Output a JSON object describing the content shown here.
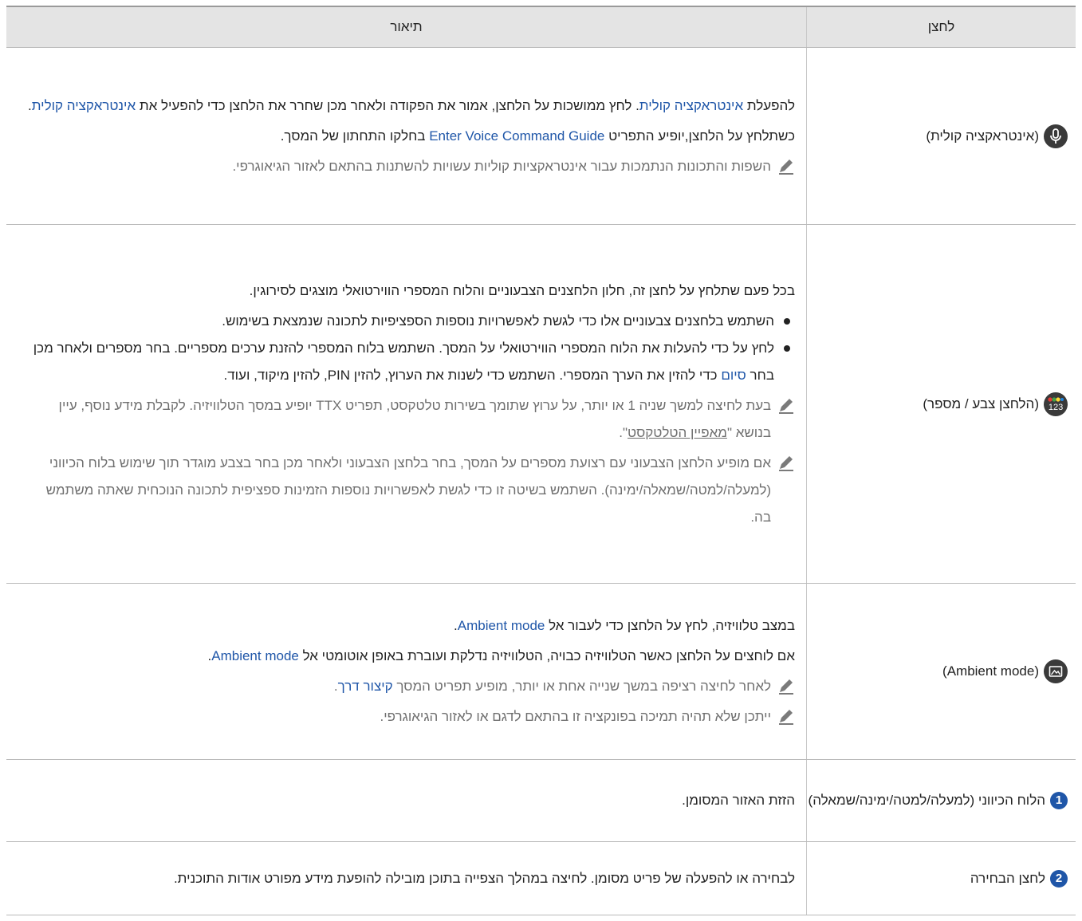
{
  "table": {
    "header": {
      "button": "לחצן",
      "description": "תיאור"
    },
    "rows": [
      {
        "button": {
          "icon": "microphone-icon",
          "label": "(אינטראקציה קולית)"
        },
        "p1": {
          "a": "להפעלת ",
          "b": "אינטראקציה קולית",
          "c": ". לחץ ממושכות על הלחצן, אמור את הפקודה ולאחר מכן שחרר את הלחצן כדי להפעיל את ",
          "d": "אינטראקציה קולית",
          "e": "."
        },
        "p2": {
          "a": "כשתלחץ על הלחצן,יופיע התפריט ",
          "b": "Enter Voice Command Guide",
          "c": " בחלקו התחתון של המסך."
        },
        "note1": "השפות והתכונות הנתמכות עבור אינטראקציות קוליות עשויות להשתנות בהתאם לאזור הגיאוגרפי."
      },
      {
        "button": {
          "icon": "color-number-icon",
          "icon_text": "123",
          "label": "(הלחצן צבע / מספר)"
        },
        "p1": "בכל פעם שתלחץ על לחצן זה, חלון הלחצנים הצבעוניים והלוח המספרי הווירטואלי מוצגים לסירוגין.",
        "bullet1": "השתמש בלחצנים צבעוניים אלו כדי לגשת לאפשרויות נוספות הספציפיות לתכונה שנמצאת בשימוש.",
        "bullet2": {
          "a": "לחץ על כדי להעלות את הלוח המספרי הווירטואלי על המסך. השתמש בלוח המספרי להזנת ערכים מספריים. בחר מספרים ולאחר מכן בחר ",
          "b": "סיום",
          "c": " כדי להזין את הערך המספרי. השתמש כדי לשנות את הערוץ, להזין PIN, להזין מיקוד, ועוד."
        },
        "note1": {
          "a": "בעת לחיצה למשך שניה 1 או יותר, על ערוץ שתומך בשירות טלטקסט, תפריט TTX יופיע במסך הטלוויזיה. לקבלת מידע נוסף, עיין בנושא \"",
          "b": "מאפיין הטלטקסט",
          "c": "\"."
        },
        "note2": "אם מופיע הלחצן הצבעוני עם רצועת מספרים על המסך, בחר בלחצן הצבעוני ולאחר מכן בחר בצבע מוגדר תוך שימוש בלוח הכיווני (למעלה/למטה/שמאלה/ימינה). השתמש בשיטה זו כדי לגשת לאפשרויות נוספות הזמינות ספציפית לתכונה הנוכחית שאתה משתמש בה."
      },
      {
        "button": {
          "icon": "ambient-mode-icon",
          "label": "(Ambient mode)"
        },
        "p1": {
          "a": "במצב טלוויזיה, לחץ על הלחצן כדי לעבור אל ",
          "b": "Ambient mode",
          "c": "."
        },
        "p2": {
          "a": "אם לוחצים על הלחצן כאשר הטלוויזיה כבויה, הטלוויזיה נדלקת ועוברת באופן אוטומטי אל ",
          "b": "Ambient mode",
          "c": "."
        },
        "note1": {
          "a": "לאחר לחיצה רציפה במשך שנייה אחת או יותר, מופיע תפריט המסך ",
          "b": "קיצור דרך",
          "c": "."
        },
        "note2": "ייתכן שלא תהיה תמיכה בפונקציה זו בהתאם לדגם או לאזור הגיאוגרפי."
      },
      {
        "button": {
          "badge": "1",
          "label": "הלוח הכיווני (למעלה/למטה/ימינה/שמאלה)"
        },
        "p1": "הזזת האזור המסומן."
      },
      {
        "button": {
          "badge": "2",
          "label": "לחצן הבחירה"
        },
        "p1": "לבחירה או להפעלה של פריט מסומן. לחיצה במהלך הצפייה בתוכן מובילה להופעת מידע מפורט אודות התוכנית."
      }
    ]
  },
  "colors": {
    "accent": "#1f56a8",
    "header_bg": "#e4e4e4",
    "note_text": "#6f6f6f"
  }
}
